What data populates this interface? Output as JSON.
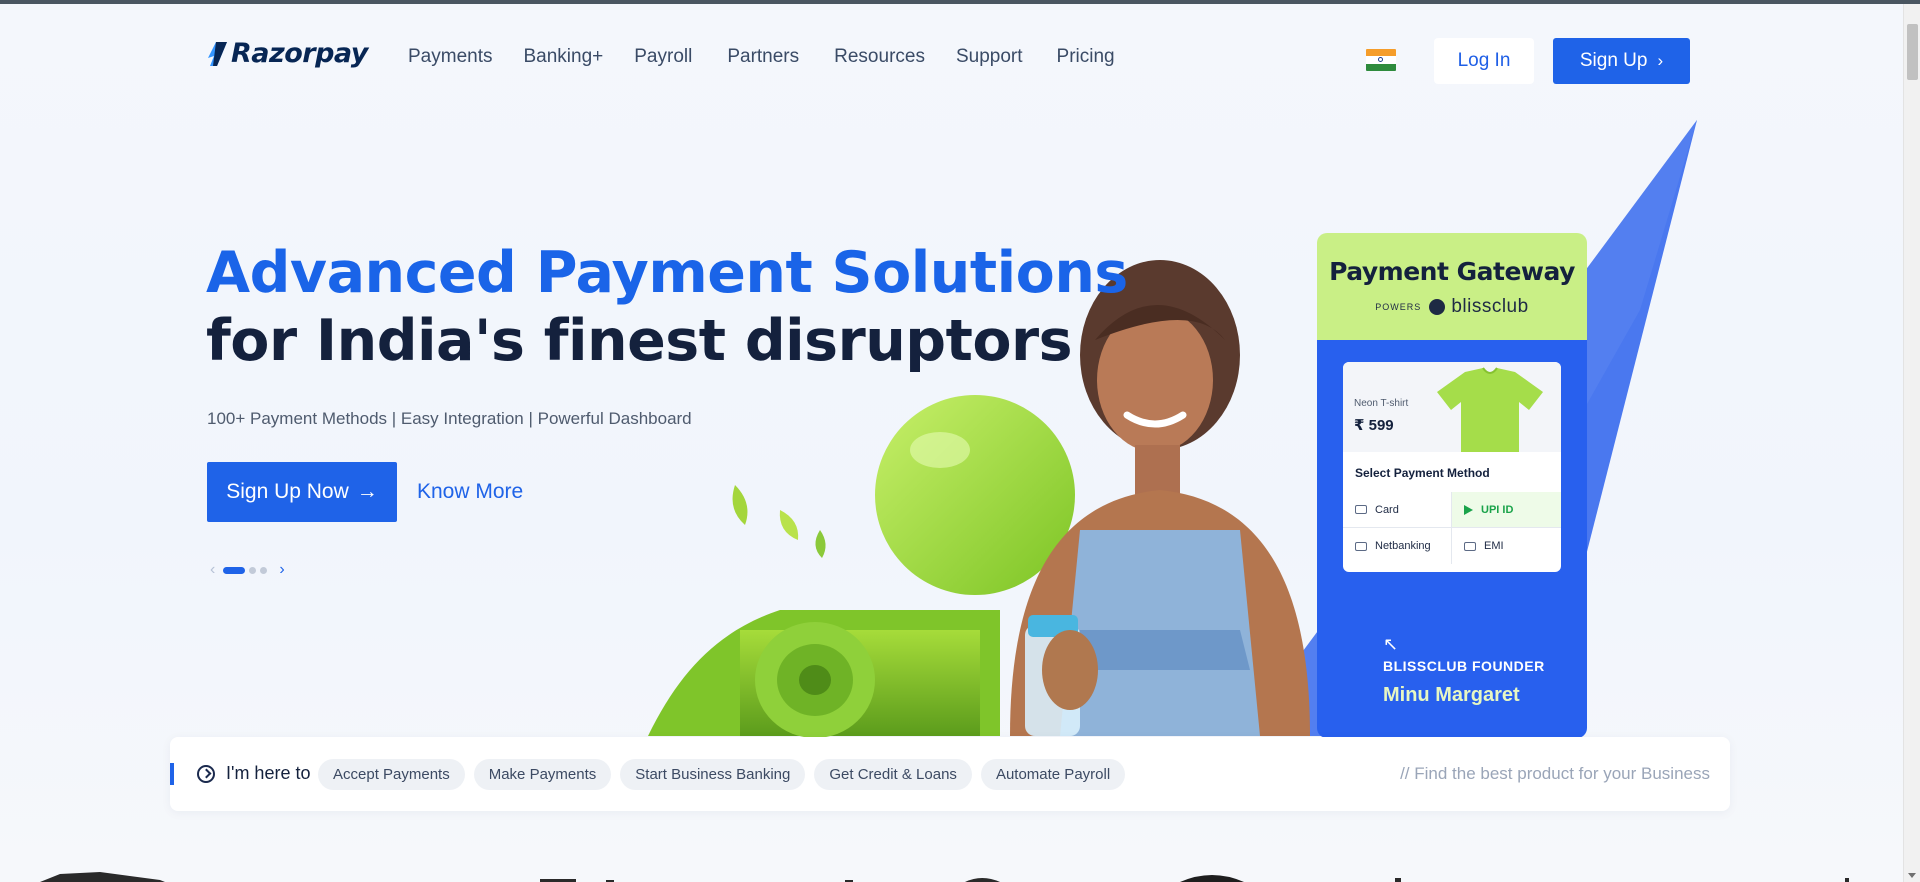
{
  "header": {
    "logo_text": "Razorpay",
    "nav": [
      "Payments",
      "Banking+",
      "Payroll",
      "Partners",
      "Resources",
      "Support",
      "Pricing"
    ],
    "country_flag": "india-flag",
    "login_label": "Log In",
    "signup_label": "Sign Up"
  },
  "hero": {
    "title_line1": "Advanced Payment Solutions",
    "title_line2": "for India's finest disruptors",
    "subtitle": "100+ Payment Methods | Easy Integration | Powerful Dashboard",
    "cta_primary": "Sign Up Now",
    "cta_secondary": "Know More",
    "carousel": {
      "total_slides": 3,
      "active_slide": 1
    }
  },
  "payment_card": {
    "title": "Payment Gateway",
    "powers_label": "POWERS",
    "brand": "blissclub",
    "product_name": "Neon T-shirt",
    "product_price": "₹ 599",
    "select_label": "Select Payment Method",
    "options": [
      {
        "label": "Card",
        "selected": false
      },
      {
        "label": "UPI ID",
        "selected": true
      },
      {
        "label": "Netbanking",
        "selected": false
      },
      {
        "label": "EMI",
        "selected": false
      }
    ],
    "founder_label": "BLISSCLUB FOUNDER",
    "founder_name": "Minu Margaret"
  },
  "intent": {
    "label": "I'm here to",
    "chips": [
      "Accept Payments",
      "Make Payments",
      "Start Business Banking",
      "Get Credit & Loans",
      "Automate Payroll"
    ],
    "hint": "// Find the best product for your Business"
  },
  "colors": {
    "brand_blue": "#1f63e8",
    "navy": "#14213d",
    "lime": "#c9ef86",
    "card_blue": "#2860ee"
  }
}
